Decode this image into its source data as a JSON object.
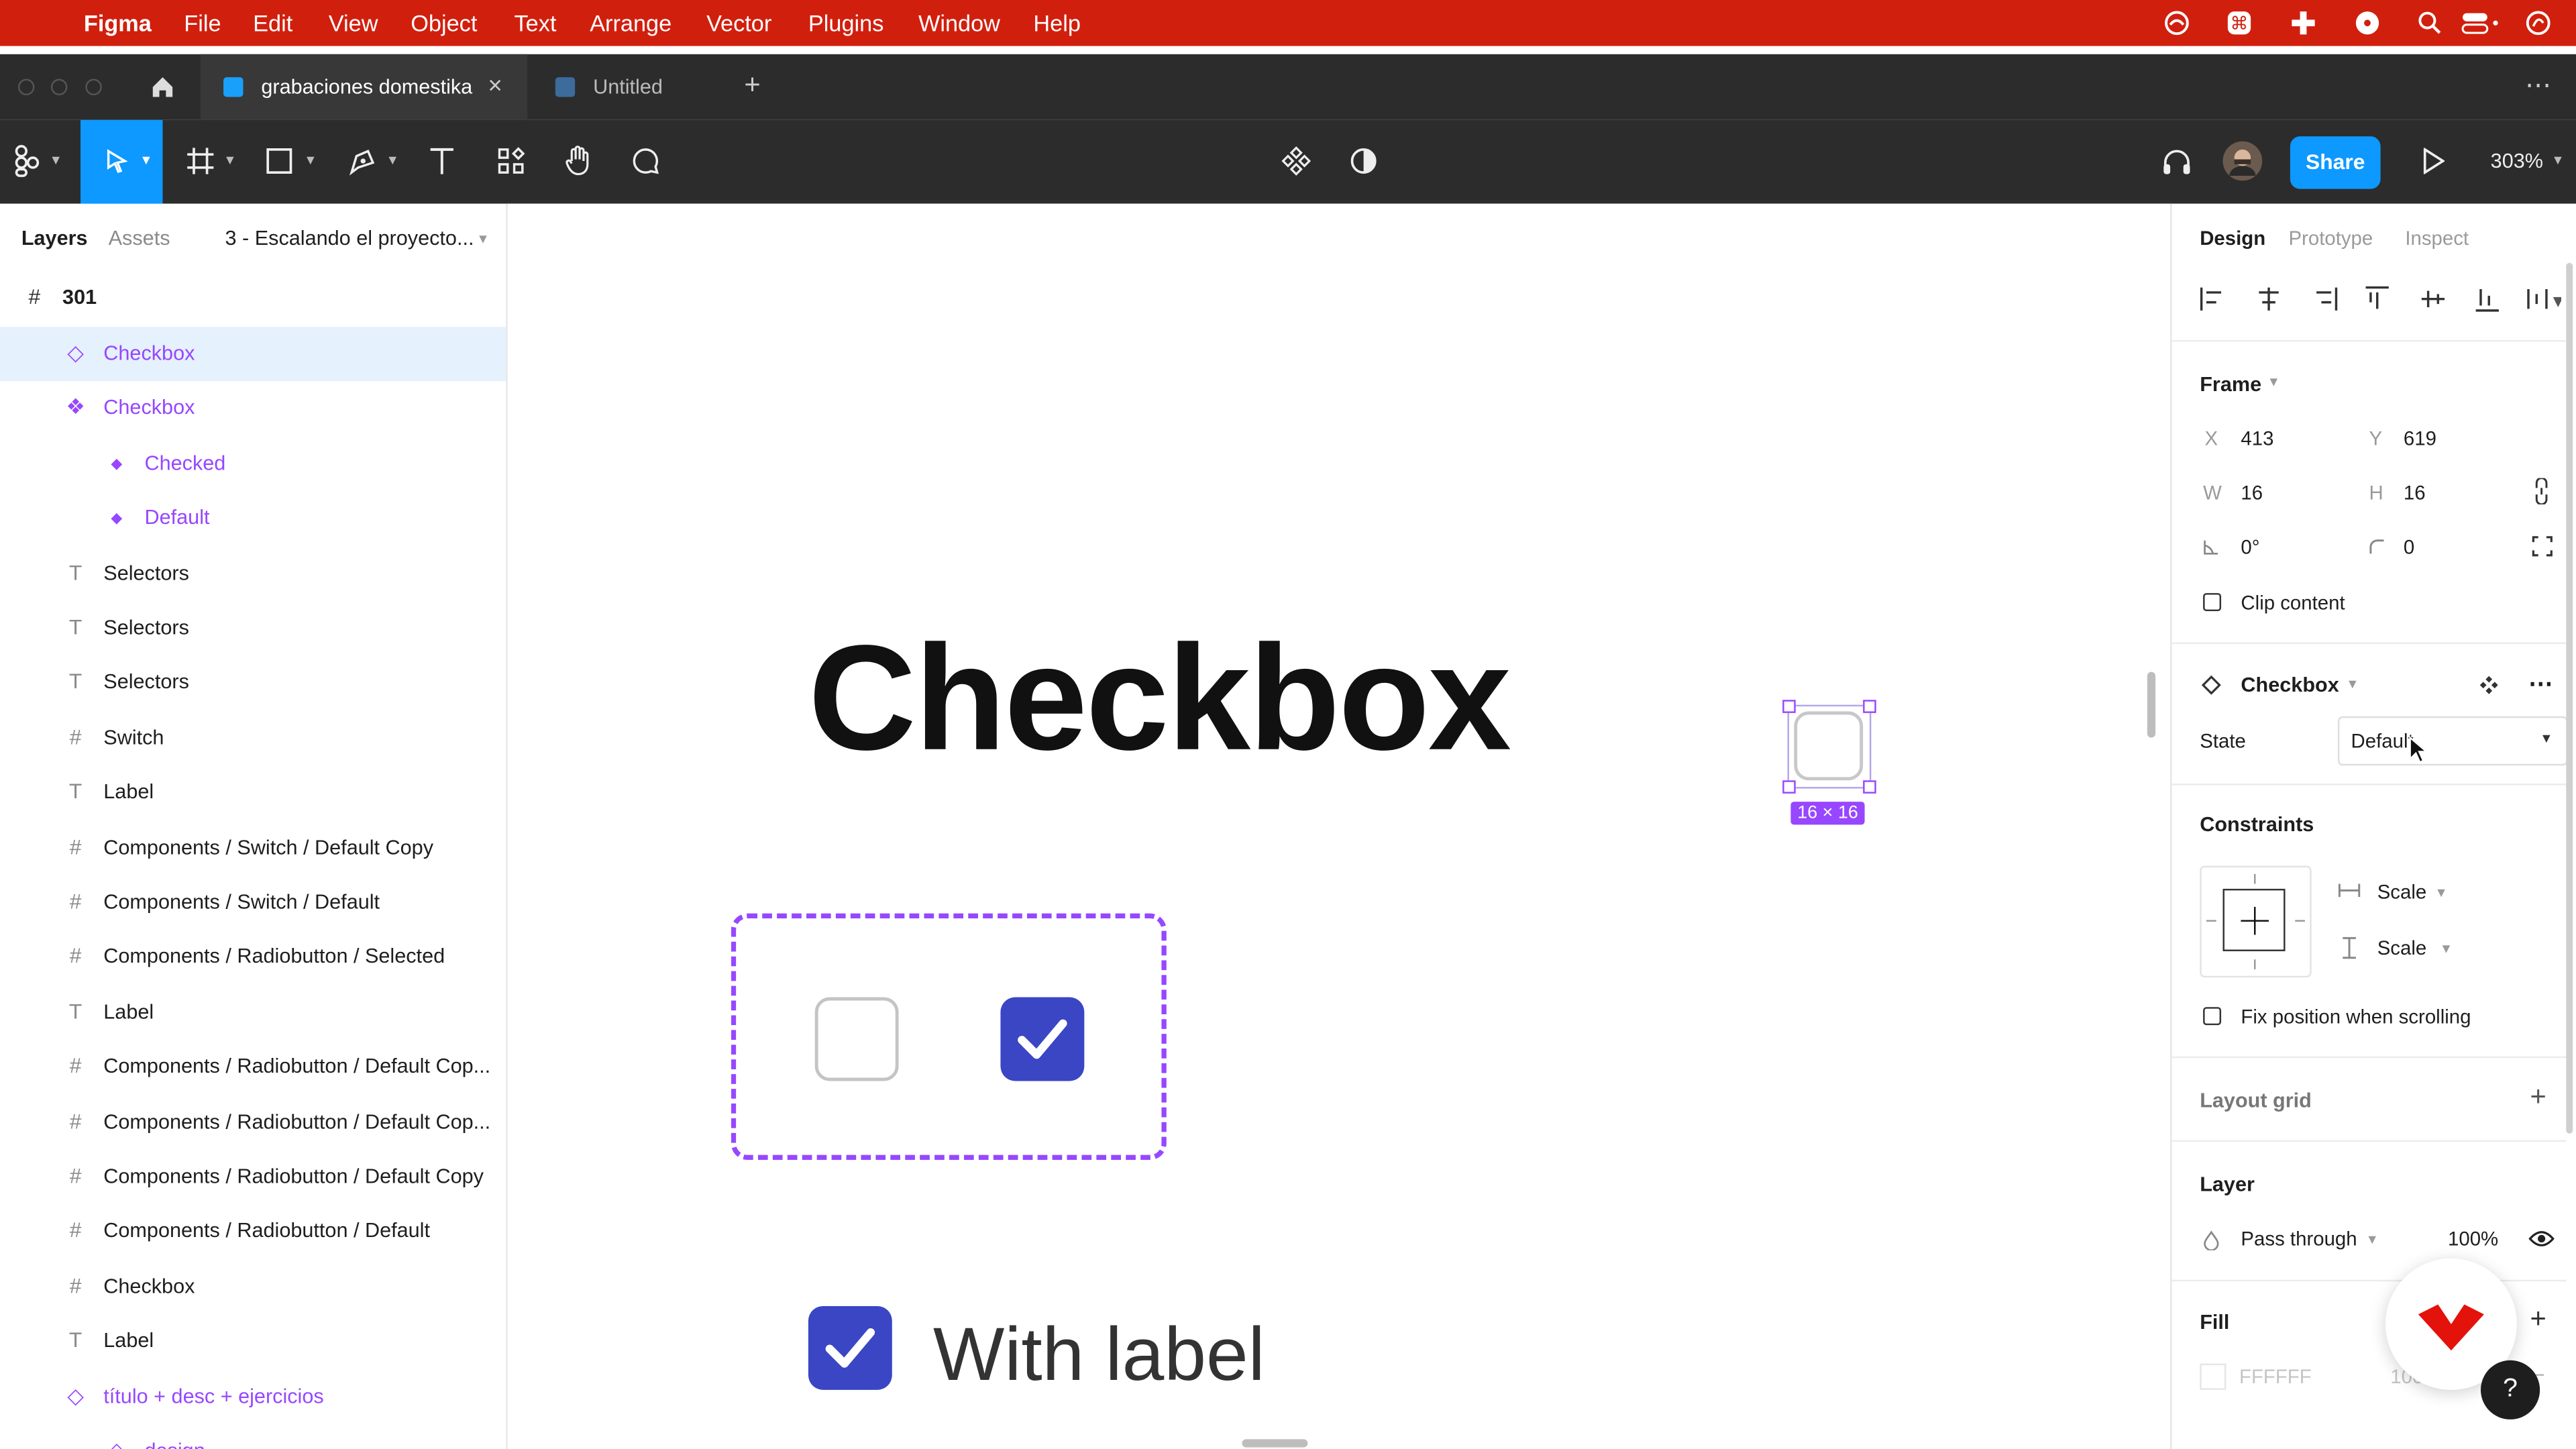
{
  "menubar": {
    "app_name": "Figma",
    "items": [
      "File",
      "Edit",
      "View",
      "Object",
      "Text",
      "Arrange",
      "Vector",
      "Plugins",
      "Window",
      "Help"
    ]
  },
  "tabs": {
    "active_file": "grabaciones domestika",
    "close_glyph": "×",
    "other_file": "Untitled",
    "new_tab_glyph": "+",
    "more_glyph": "⋯"
  },
  "toolbar": {
    "share_label": "Share",
    "zoom": "303%",
    "colors": {
      "accent": "#0d99ff",
      "bar": "#2c2c2c",
      "menubar": "#d11f0e"
    }
  },
  "left_panel": {
    "tabs": [
      "Layers",
      "Assets"
    ],
    "page_name": "3 - Escalando el proyecto...",
    "root_frame": "301",
    "layers": [
      {
        "label": "Checkbox",
        "icon": "component-set-icon",
        "indent": 1,
        "selected": true,
        "component": true
      },
      {
        "label": "Checkbox",
        "icon": "variants-icon",
        "indent": 1,
        "component": true
      },
      {
        "label": "Checked",
        "icon": "variant-icon",
        "indent": 2,
        "component": true
      },
      {
        "label": "Default",
        "icon": "variant-icon",
        "indent": 2,
        "component": true
      },
      {
        "label": "Selectors",
        "icon": "text-icon",
        "indent": 1
      },
      {
        "label": "Selectors",
        "icon": "text-icon",
        "indent": 1
      },
      {
        "label": "Selectors",
        "icon": "text-icon",
        "indent": 1
      },
      {
        "label": "Switch",
        "icon": "frame-icon",
        "indent": 1
      },
      {
        "label": "Label",
        "icon": "text-icon",
        "indent": 1
      },
      {
        "label": "Components / Switch / Default Copy",
        "icon": "frame-icon",
        "indent": 1
      },
      {
        "label": "Components / Switch / Default",
        "icon": "frame-icon",
        "indent": 1
      },
      {
        "label": "Components / Radiobutton / Selected",
        "icon": "frame-icon",
        "indent": 1
      },
      {
        "label": "Label",
        "icon": "text-icon",
        "indent": 1
      },
      {
        "label": "Components / Radiobutton / Default Cop...",
        "icon": "frame-icon",
        "indent": 1
      },
      {
        "label": "Components / Radiobutton / Default Cop...",
        "icon": "frame-icon",
        "indent": 1
      },
      {
        "label": "Components / Radiobutton / Default Copy",
        "icon": "frame-icon",
        "indent": 1
      },
      {
        "label": "Components / Radiobutton / Default",
        "icon": "frame-icon",
        "indent": 1
      },
      {
        "label": "Checkbox",
        "icon": "frame-icon",
        "indent": 1
      },
      {
        "label": "Label",
        "icon": "text-icon",
        "indent": 1
      },
      {
        "label": "título + desc + ejercicios",
        "icon": "component-set-icon",
        "indent": 1,
        "component": true
      },
      {
        "label": "design",
        "icon": "component-set-icon",
        "indent": 2,
        "component": true
      }
    ]
  },
  "canvas": {
    "heading": "Checkbox",
    "size_badge": "16 × 16",
    "with_label_text": "With label",
    "colors": {
      "component_border": "#9747ff",
      "checked_fill": "#3a46c4"
    }
  },
  "right_panel": {
    "tabs": [
      "Design",
      "Prototype",
      "Inspect"
    ],
    "frame_section": "Frame",
    "x_label": "X",
    "x_value": "413",
    "y_label": "Y",
    "y_value": "619",
    "w_label": "W",
    "w_value": "16",
    "h_label": "H",
    "h_value": "16",
    "rotation": "0°",
    "radius": "0",
    "clip_content": "Clip content",
    "instance_name": "Checkbox",
    "state_label": "State",
    "state_value": "Default",
    "constraints_section": "Constraints",
    "constraint_h": "Scale",
    "constraint_v": "Scale",
    "fix_position": "Fix position when scrolling",
    "layout_grid": "Layout grid",
    "layer_section": "Layer",
    "blend_mode": "Pass through",
    "opacity": "100%",
    "fill_section": "Fill",
    "fill_hex": "FFFFFF",
    "fill_opacity": "100%",
    "help_glyph": "?"
  }
}
